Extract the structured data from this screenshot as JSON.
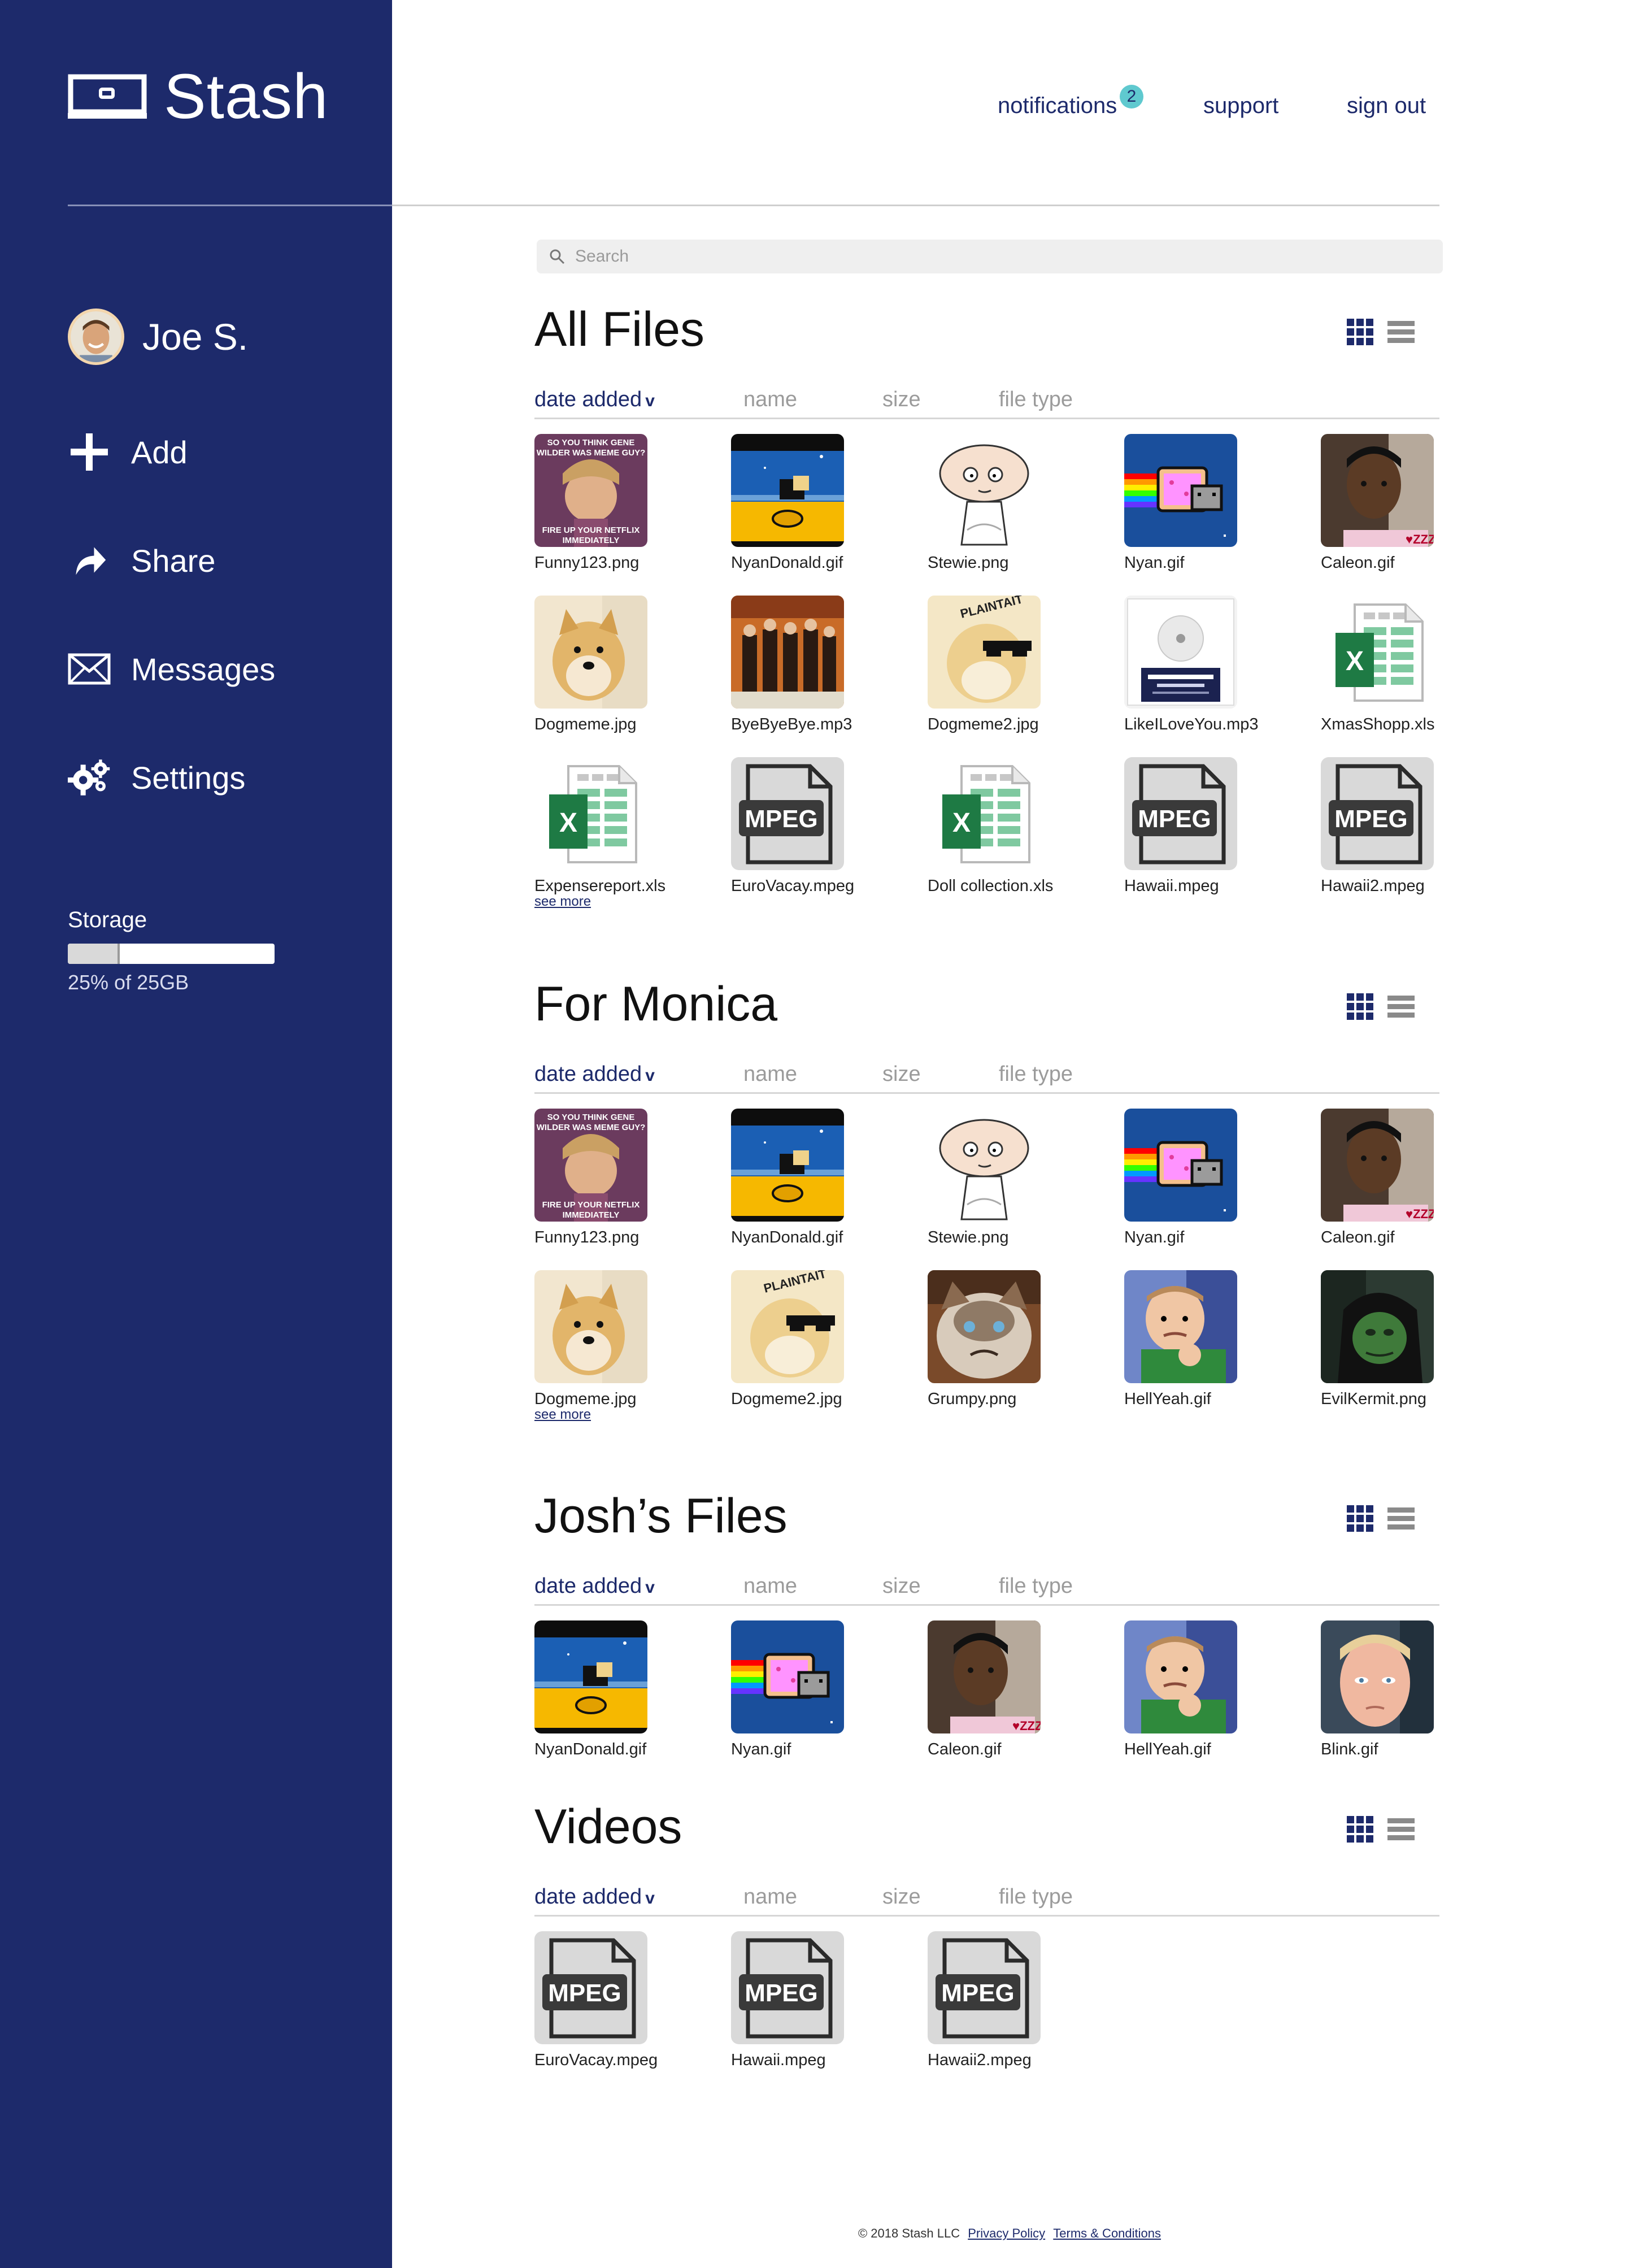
{
  "app": {
    "name": "Stash"
  },
  "colors": {
    "brand": "#1d2a6b",
    "badge": "#5fc9cf",
    "excel": "#1e7a44",
    "nyan_bg": "#1a4f9c"
  },
  "user": {
    "name": "Joe S."
  },
  "nav": [
    {
      "label": "Add",
      "icon": "plus-icon"
    },
    {
      "label": "Share",
      "icon": "share-arrow-icon"
    },
    {
      "label": "Messages",
      "icon": "envelope-icon"
    },
    {
      "label": "Settings",
      "icon": "gears-icon"
    }
  ],
  "storage": {
    "label": "Storage",
    "used_text": "25% of 25GB",
    "used_fraction": 0.25
  },
  "header": {
    "notifications": "notifications",
    "notification_count": "2",
    "support": "support",
    "sign_out": "sign out"
  },
  "search": {
    "placeholder": "Search"
  },
  "sort": {
    "date_added": "date added",
    "name": "name",
    "size": "size",
    "file_type": "file type",
    "arrow": "v"
  },
  "see_more": "see more",
  "sections": [
    {
      "title": "All Files",
      "files": [
        {
          "name": "Funny123.png",
          "thumb": "wonka"
        },
        {
          "name": "NyanDonald.gif",
          "thumb": "nyandonald"
        },
        {
          "name": "Stewie.png",
          "thumb": "stewie"
        },
        {
          "name": "Nyan.gif",
          "thumb": "nyan"
        },
        {
          "name": "Caleon.gif",
          "thumb": "caleon"
        },
        {
          "name": "Dogmeme.jpg",
          "thumb": "doge"
        },
        {
          "name": "ByeByeBye.mp3",
          "thumb": "nsync"
        },
        {
          "name": "Dogmeme2.jpg",
          "thumb": "doge2"
        },
        {
          "name": "LikeILoveYou.mp3",
          "thumb": "album"
        },
        {
          "name": "XmasShopp.xls",
          "thumb": "excel"
        },
        {
          "name": "Expensereport.xls",
          "thumb": "excel"
        },
        {
          "name": "EuroVacay.mpeg",
          "thumb": "mpeg"
        },
        {
          "name": "Doll collection.xls",
          "thumb": "excel"
        },
        {
          "name": "Hawaii.mpeg",
          "thumb": "mpeg"
        },
        {
          "name": "Hawaii2.mpeg",
          "thumb": "mpeg"
        }
      ],
      "see_more": true
    },
    {
      "title": "For Monica",
      "files": [
        {
          "name": "Funny123.png",
          "thumb": "wonka"
        },
        {
          "name": "NyanDonald.gif",
          "thumb": "nyandonald"
        },
        {
          "name": "Stewie.png",
          "thumb": "stewie"
        },
        {
          "name": "Nyan.gif",
          "thumb": "nyan"
        },
        {
          "name": "Caleon.gif",
          "thumb": "caleon"
        },
        {
          "name": "Dogmeme.jpg",
          "thumb": "doge"
        },
        {
          "name": "Dogmeme2.jpg",
          "thumb": "doge2"
        },
        {
          "name": "Grumpy.png",
          "thumb": "grumpy"
        },
        {
          "name": "HellYeah.gif",
          "thumb": "baby"
        },
        {
          "name": "EvilKermit.png",
          "thumb": "kermit"
        }
      ],
      "see_more": true
    },
    {
      "title": "Josh’s Files",
      "files": [
        {
          "name": "NyanDonald.gif",
          "thumb": "nyandonald"
        },
        {
          "name": "Nyan.gif",
          "thumb": "nyan"
        },
        {
          "name": "Caleon.gif",
          "thumb": "caleon"
        },
        {
          "name": "HellYeah.gif",
          "thumb": "baby"
        },
        {
          "name": "Blink.gif",
          "thumb": "blink"
        }
      ],
      "see_more": false
    },
    {
      "title": "Videos",
      "files": [
        {
          "name": "EuroVacay.mpeg",
          "thumb": "mpeg"
        },
        {
          "name": "Hawaii.mpeg",
          "thumb": "mpeg"
        },
        {
          "name": "Hawaii2.mpeg",
          "thumb": "mpeg"
        }
      ],
      "see_more": false
    }
  ],
  "footer": {
    "copyright": "© 2018 Stash LLC",
    "privacy": "Privacy Policy",
    "terms": "Terms & Conditions"
  },
  "thumb_labels": {
    "wonka_top": "SO YOU THINK GENE WILDER WAS MEME GUY?",
    "wonka_bottom": "FIRE UP YOUR NETFLIX IMMEDIATELY",
    "mpeg": "MPEG",
    "excel": "X",
    "doge2": "PLAINTAIT"
  }
}
